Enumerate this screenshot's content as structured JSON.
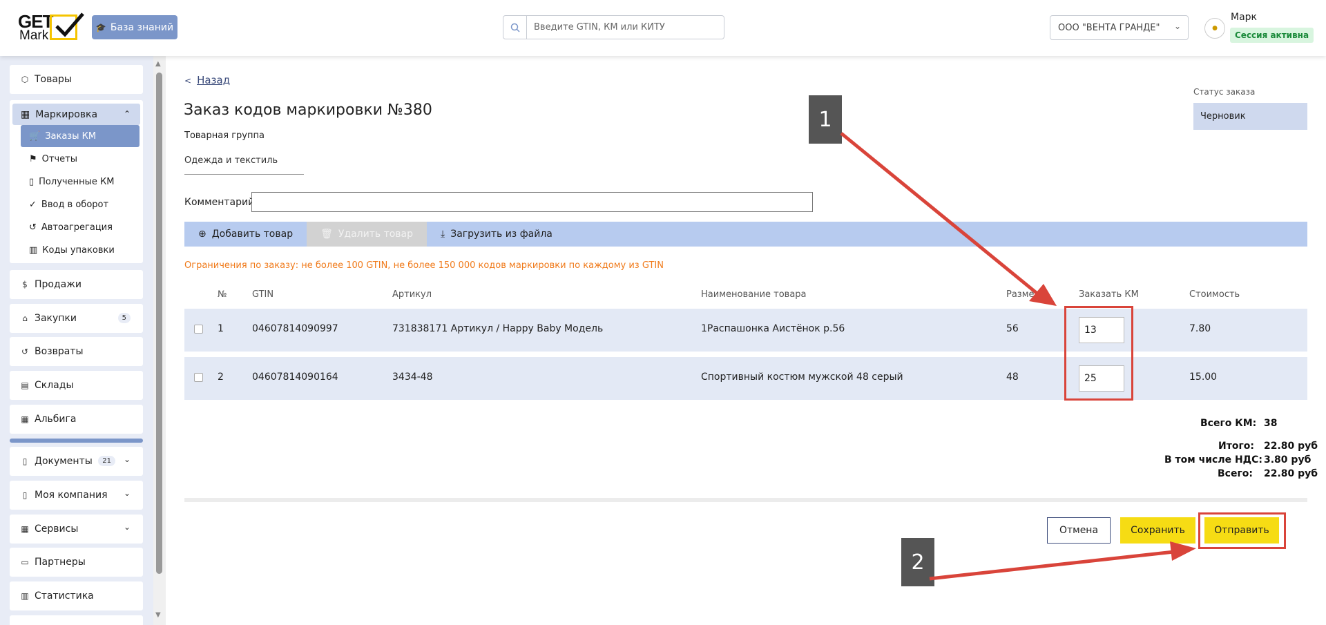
{
  "header": {
    "logo_top": "GET",
    "logo_bottom": "Mark",
    "knowledge_base": "База знаний",
    "search_placeholder": "Введите GTIN, КМ или КИТУ",
    "org": "ООО \"ВЕНТА ГРАНДЕ\"",
    "user_name": "Марк",
    "session_status": "Сессия активна"
  },
  "sidebar": {
    "goods": "Товары",
    "marking": "Маркировка",
    "sub": [
      "Заказы КМ",
      "Отчеты",
      "Полученные КМ",
      "Ввод в оборот",
      "Автоагрегация",
      "Коды упаковки"
    ],
    "sales": "Продажи",
    "purchases": "Закупки",
    "purchases_count": "5",
    "returns": "Возвраты",
    "warehouses": "Склады",
    "albiga": "Альбига",
    "documents": "Документы",
    "documents_count": "21",
    "my_company": "Моя компания",
    "services": "Сервисы",
    "partners": "Партнеры",
    "stats": "Статистика"
  },
  "main": {
    "back": "Назад",
    "title": "Заказ кодов маркировки №380",
    "group_label": "Товарная группа",
    "group_value": "Одежда и текстиль",
    "comment_label": "Комментарий:",
    "status_label": "Статус заказа",
    "status_value": "Черновик",
    "toolbar": {
      "add": "Добавить товар",
      "delete": "Удалить товар",
      "upload": "Загрузить из файла"
    },
    "limits": "Ограничения по заказу: не более 100 GTIN, не более 150 000 кодов маркировки по каждому из GTIN",
    "columns": [
      "№",
      "GTIN",
      "Артикул",
      "Наименование товара",
      "Размер",
      "Заказать КМ",
      "Стоимость"
    ],
    "rows": [
      {
        "n": "1",
        "gtin": "04607814090997",
        "article": "731838171 Артикул / Happy Baby Модель",
        "name": "1Распашонка Аистёнок р.56",
        "size": "56",
        "qty": "13",
        "cost": "7.80"
      },
      {
        "n": "2",
        "gtin": "04607814090164",
        "article": "3434-48",
        "name": "Спортивный костюм мужской 48 серый",
        "size": "48",
        "qty": "25",
        "cost": "15.00"
      }
    ],
    "totals": {
      "km_label": "Всего КМ:",
      "km_value": "38",
      "total_label": "Итого:",
      "total_value": "22.80 руб",
      "vat_label": "В том числе НДС:",
      "vat_value": "3.80 руб",
      "all_label": "Всего:",
      "all_value": "22.80 руб"
    },
    "buttons": {
      "cancel": "Отмена",
      "save": "Сохранить",
      "send": "Отправить"
    }
  },
  "annotations": {
    "callout_1": "1",
    "callout_2": "2",
    "color": "#d9443a"
  }
}
